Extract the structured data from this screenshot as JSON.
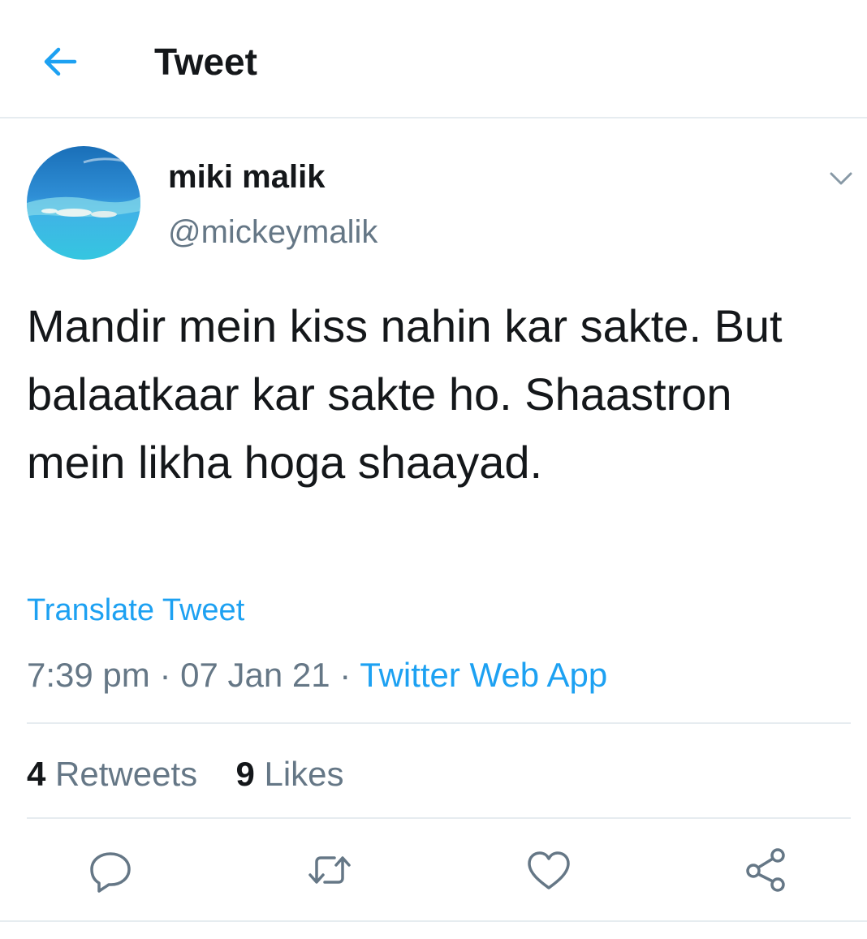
{
  "header": {
    "title": "Tweet",
    "back_icon": "arrow-left-icon"
  },
  "colors": {
    "accent": "#1da1f2",
    "secondary_text": "#657786",
    "primary_text": "#14171a",
    "divider": "#e6ecf0"
  },
  "author": {
    "display_name": "miki malik",
    "handle": "@mickeymalik"
  },
  "tweet": {
    "text": "Mandir mein kiss nahin kar sakte. But balaatkaar kar sakte ho. Shaastron mein likha hoga shaayad.",
    "translate_label": "Translate Tweet",
    "time": "7:39 pm",
    "separator": "·",
    "date": "07 Jan 21",
    "source": "Twitter Web App"
  },
  "stats": {
    "retweets_count": "4",
    "retweets_label": "Retweets",
    "likes_count": "9",
    "likes_label": "Likes"
  },
  "actions": [
    "reply-icon",
    "retweet-icon",
    "like-icon",
    "share-icon"
  ]
}
